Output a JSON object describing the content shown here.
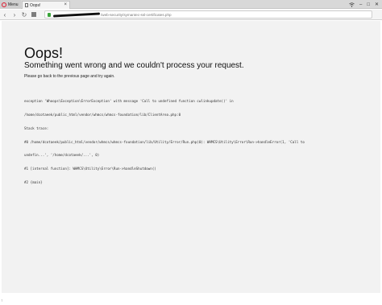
{
  "browser": {
    "menu_label": "Menu",
    "tab_title": "Oops!",
    "tab_close": "×",
    "url_visible": "/web-security/symantec-ssl-certificates.php",
    "controls": [
      "wifi",
      "minimize",
      "maximize",
      "close"
    ]
  },
  "page": {
    "heading": "Oops!",
    "subtitle": "Something went wrong and we couldn't process your request.",
    "instruction": "Please go back to the previous page and try again.",
    "trace_lines": [
      "exception 'Whoops\\Exception\\ErrorException' with message 'Call to undefined function cwlinkupdate()' in",
      "/home/dcotaeek/public_html/vendor/whmcs/whmcs-foundation/lib/ClientArea.php:0",
      "Stack trace:",
      "#0 /home/dcotaeek/public_html/vendor/whmcs/whmcs-foundation/lib/Utility/Error/Run.php(0): WHMCS\\Utility\\Error\\Run->handleError(1, 'Call to",
      "undefin...', '/home/dcotaeek/...', 0)",
      "#1 [internal function]: WHMCS\\Utility\\Error\\Run->handleShutdown()",
      "#2 {main}"
    ]
  },
  "colors": {
    "page_bg": "#f2f2f2",
    "lock_green": "#3aa53a",
    "opera_red": "#e0182d"
  }
}
